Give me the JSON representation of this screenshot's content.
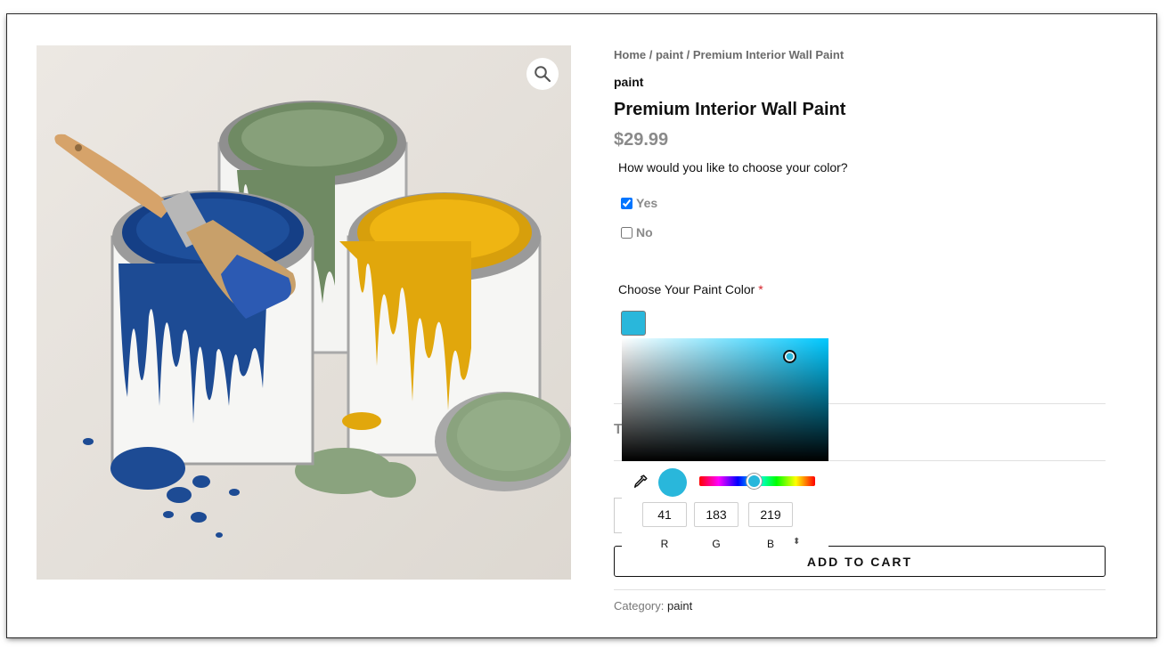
{
  "breadcrumb": {
    "home": "Home",
    "sep1": " / ",
    "category": "paint",
    "sep2": " / ",
    "current": "Premium Interior Wall Paint"
  },
  "product": {
    "brand": "paint",
    "title": "Premium Interior Wall Paint",
    "price": "$29.99"
  },
  "color_choice": {
    "question": "How would you like to choose your color?",
    "options": [
      {
        "label": "Yes",
        "checked": true
      },
      {
        "label": "No",
        "checked": false
      }
    ]
  },
  "paint_color": {
    "label": "Choose Your Paint Color",
    "required_mark": "*",
    "swatch_color": "#29b7db"
  },
  "picker": {
    "hue_color": "#00c8ff",
    "selected_color": "#29b7db",
    "r": "41",
    "g": "183",
    "b": "219",
    "r_label": "R",
    "g_label": "G",
    "b_label": "B",
    "mode_toggle": "⬍"
  },
  "hidden_stub": "T",
  "cart": {
    "button_label": "ADD TO CART"
  },
  "category": {
    "label": "Category: ",
    "value": "paint"
  },
  "icons": {
    "zoom": "magnifier-icon",
    "eyedropper": "eyedropper-icon"
  }
}
